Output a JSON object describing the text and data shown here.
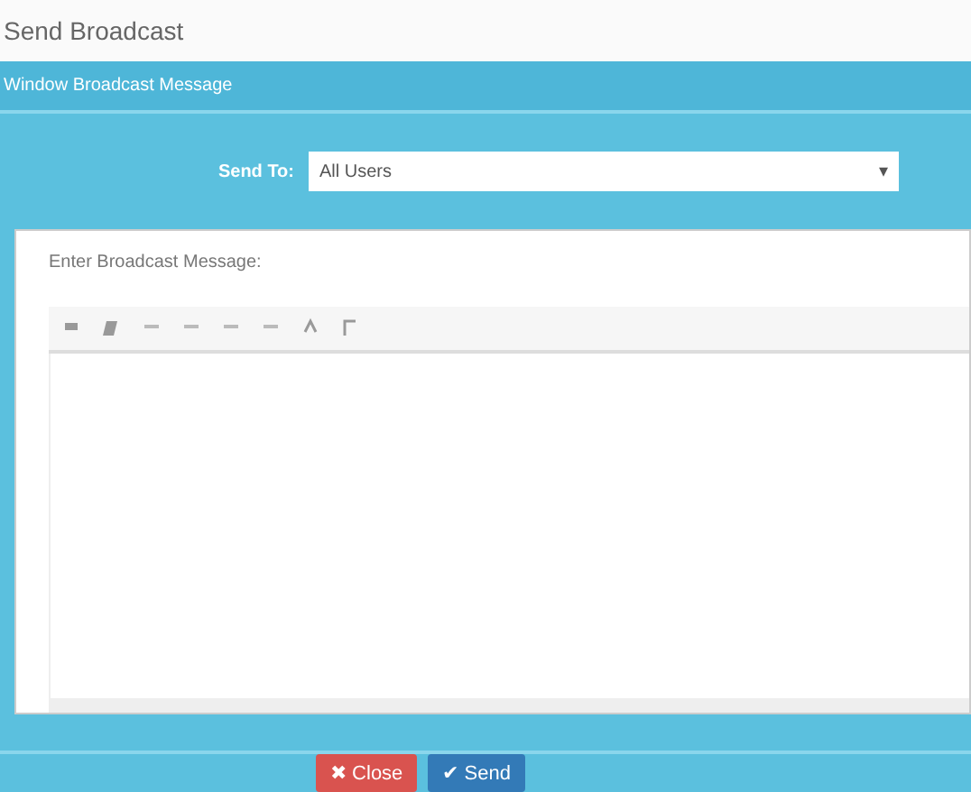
{
  "page_title": "Send Broadcast",
  "panel": {
    "title": "Window Broadcast Message"
  },
  "form": {
    "label": "Send To:",
    "select_value": "All Users",
    "select_caret": "▾"
  },
  "editor": {
    "label": "Enter Broadcast Message:",
    "toolbar": [
      {
        "kind": "bold"
      },
      {
        "kind": "italic"
      },
      {
        "kind": "list"
      },
      {
        "kind": "list"
      },
      {
        "kind": "list"
      },
      {
        "kind": "list"
      },
      {
        "kind": "undo"
      },
      {
        "kind": "link"
      }
    ]
  },
  "buttons": [
    {
      "kind": "danger",
      "icon": "✖",
      "label": "Close"
    },
    {
      "kind": "primary",
      "icon": "✔",
      "label": "Send"
    }
  ]
}
